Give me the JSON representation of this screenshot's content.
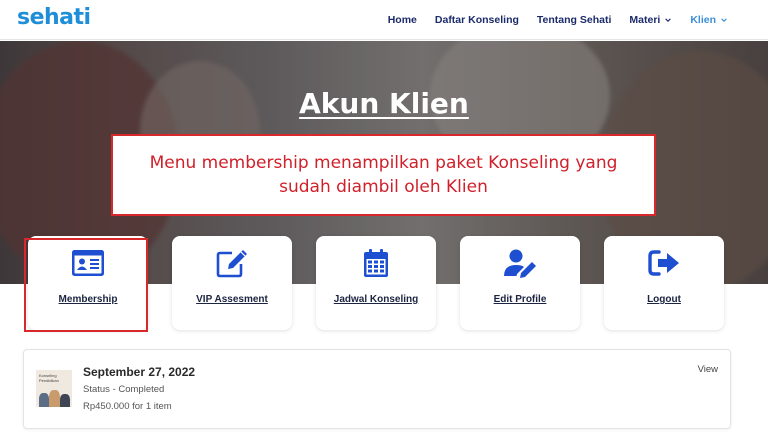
{
  "brand": {
    "logo_text": "sehati"
  },
  "nav": {
    "items": [
      {
        "label": "Home"
      },
      {
        "label": "Daftar Konseling"
      },
      {
        "label": "Tentang Sehati"
      },
      {
        "label": "Materi"
      },
      {
        "label": "Klien"
      }
    ]
  },
  "hero": {
    "title": "Akun Klien"
  },
  "annotation": {
    "text": "Menu membership menampilkan paket Konseling yang sudah diambil oleh Klien"
  },
  "account_menu": [
    {
      "label": "Membership",
      "icon": "id-card-icon"
    },
    {
      "label": "VIP Assesment",
      "icon": "edit-icon"
    },
    {
      "label": "Jadwal Konseling",
      "icon": "calendar-icon"
    },
    {
      "label": "Edit Profile",
      "icon": "user-edit-icon"
    },
    {
      "label": "Logout",
      "icon": "sign-out-icon"
    }
  ],
  "order": {
    "thumb_text": "Konseling Pendidikan",
    "date": "September 27, 2022",
    "status": "Status - Completed",
    "price": "Rp450.000 for 1 item",
    "view_label": "View"
  },
  "colors": {
    "accent": "#1f4fd1",
    "nav_text": "#1b2b6b",
    "nav_active": "#3a8fd8",
    "annotation": "#d8282b"
  }
}
